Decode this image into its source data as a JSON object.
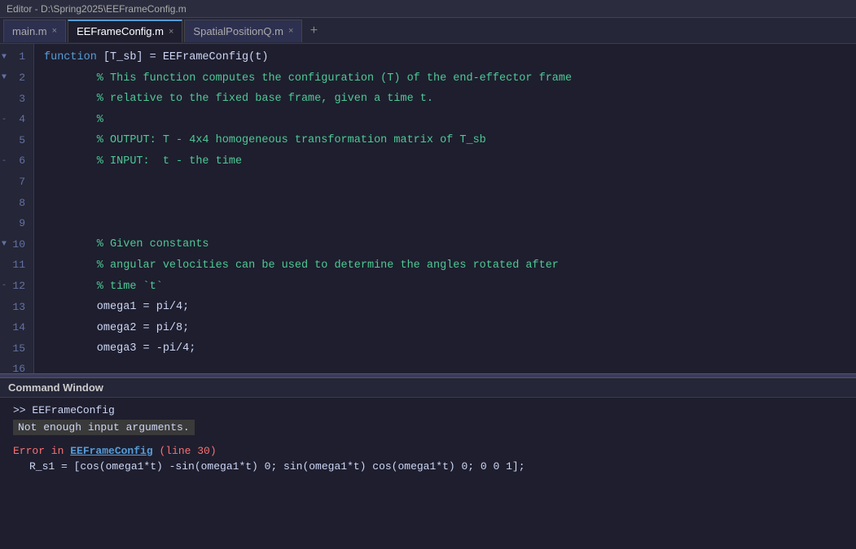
{
  "titleBar": {
    "text": "Editor - D:\\Spring2025\\EEFrameConfig.m"
  },
  "tabs": [
    {
      "id": "main",
      "label": "main.m",
      "closable": true,
      "active": false
    },
    {
      "id": "eeframe",
      "label": "EEFrameConfig.m",
      "closable": true,
      "active": true
    },
    {
      "id": "spatial",
      "label": "SpatialPositionQ.m",
      "closable": true,
      "active": false
    }
  ],
  "addTabLabel": "+",
  "codeLines": [
    {
      "num": 1,
      "fold": "▼",
      "text": "function [T_sb] = EEFrameConfig(t)",
      "type": "keyword"
    },
    {
      "num": 2,
      "fold": "▼",
      "text": "        % This function computes the configuration (T) of the end-effector frame",
      "type": "comment"
    },
    {
      "num": 3,
      "fold": null,
      "text": "        % relative to the fixed base frame, given a time t.",
      "type": "comment"
    },
    {
      "num": 4,
      "fold": "-",
      "text": "        %",
      "type": "comment"
    },
    {
      "num": 5,
      "fold": null,
      "text": "        % OUTPUT: T - 4x4 homogeneous transformation matrix of T_sb",
      "type": "comment"
    },
    {
      "num": 6,
      "fold": "-",
      "text": "        % INPUT:  t - the time",
      "type": "comment"
    },
    {
      "num": 7,
      "fold": null,
      "text": "",
      "type": "plain"
    },
    {
      "num": 8,
      "fold": null,
      "text": "",
      "type": "plain"
    },
    {
      "num": 9,
      "fold": null,
      "text": "",
      "type": "plain"
    },
    {
      "num": 10,
      "fold": "▼",
      "text": "        % Given constants",
      "type": "comment"
    },
    {
      "num": 11,
      "fold": null,
      "text": "        % angular velocities can be used to determine the angles rotated after",
      "type": "comment"
    },
    {
      "num": 12,
      "fold": "-",
      "text": "        % time `t`",
      "type": "comment"
    },
    {
      "num": 13,
      "fold": null,
      "text": "        omega1 = pi/4;",
      "type": "code"
    },
    {
      "num": 14,
      "fold": null,
      "text": "        omega2 = pi/8;",
      "type": "code"
    },
    {
      "num": 15,
      "fold": null,
      "text": "        omega3 = -pi/4;",
      "type": "code"
    },
    {
      "num": 16,
      "fold": null,
      "text": "",
      "type": "plain"
    }
  ],
  "commandWindow": {
    "title": "Command Window",
    "prompt": ">> EEFrameConfig",
    "errorBox": "Not enough input arguments.",
    "errorLine": "Error in EEFrameConfig (line 30)",
    "errorLinkText": "EEFrameConfig",
    "errorLineRef": "(line 30)",
    "codeLine": "    R_s1 = [cos(omega1*t) -sin(omega1*t) 0; sin(omega1*t) cos(omega1*t) 0; 0 0 1];"
  }
}
